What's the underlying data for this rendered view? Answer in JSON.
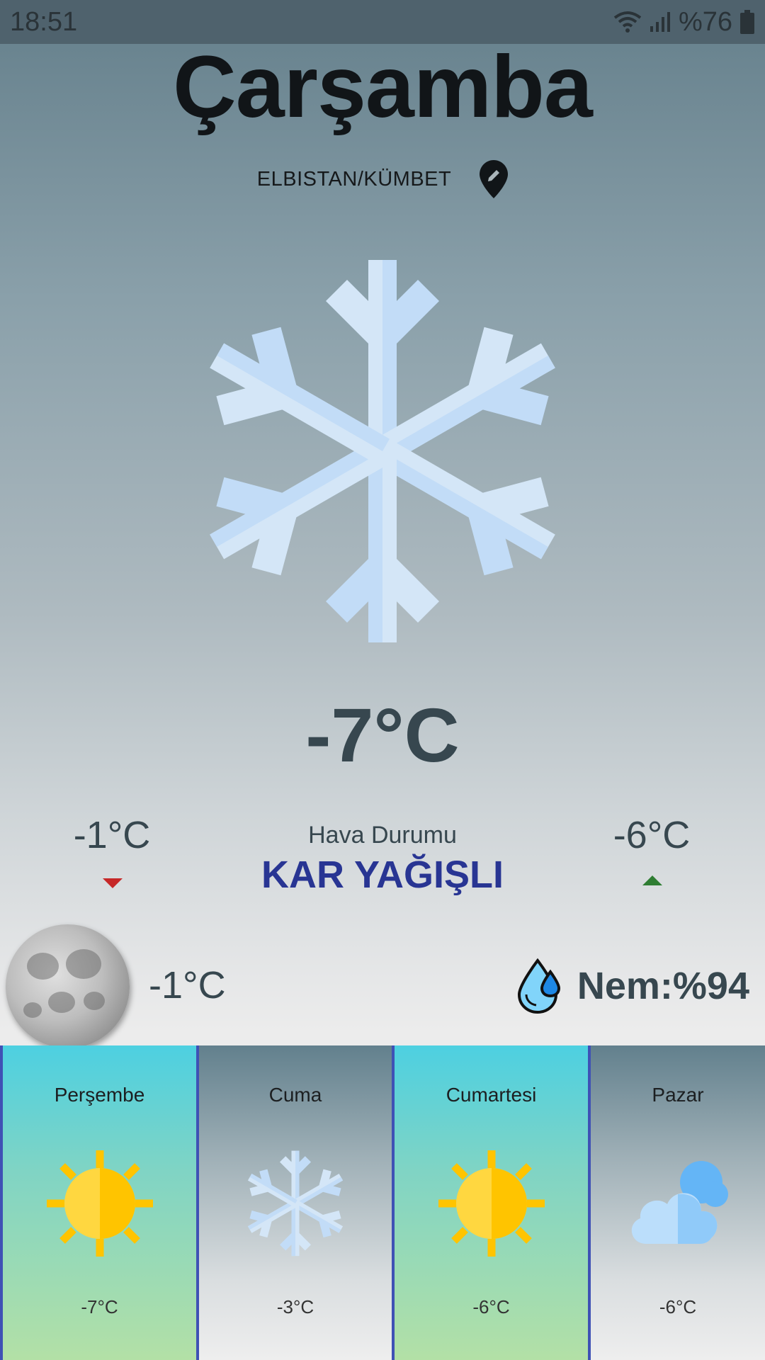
{
  "status_bar": {
    "time": "18:51",
    "battery": "%76",
    "icons": [
      "wifi-icon",
      "signal-icon",
      "battery-icon"
    ]
  },
  "header": {
    "day": "Çarşamba",
    "location": "ELBISTAN/KÜMBET",
    "location_icon": "location-edit-icon"
  },
  "current": {
    "icon": "snowflake-icon",
    "temperature": "-7°C",
    "low": "-1°C",
    "high": "-6°C",
    "condition_label": "Hava Durumu",
    "condition_value": "KAR YAĞIŞLI"
  },
  "night": {
    "icon": "moon-icon",
    "temperature": "-1°C"
  },
  "humidity": {
    "icon": "water-drops-icon",
    "text": "Nem:%94"
  },
  "forecast": [
    {
      "day": "Perşembe",
      "icon": "sun-icon",
      "temp": "-7°C",
      "style": "sunny"
    },
    {
      "day": "Cuma",
      "icon": "snowflake-icon",
      "temp": "-3°C",
      "style": "cold"
    },
    {
      "day": "Cumartesi",
      "icon": "sun-icon",
      "temp": "-6°C",
      "style": "sunny"
    },
    {
      "day": "Pazar",
      "icon": "cloud-icon",
      "temp": "-6°C",
      "style": "cold"
    }
  ],
  "colors": {
    "condition": "#283593",
    "low_arrow": "#c62828",
    "high_arrow": "#2e7d32",
    "card_divider": "#3f51b5"
  }
}
